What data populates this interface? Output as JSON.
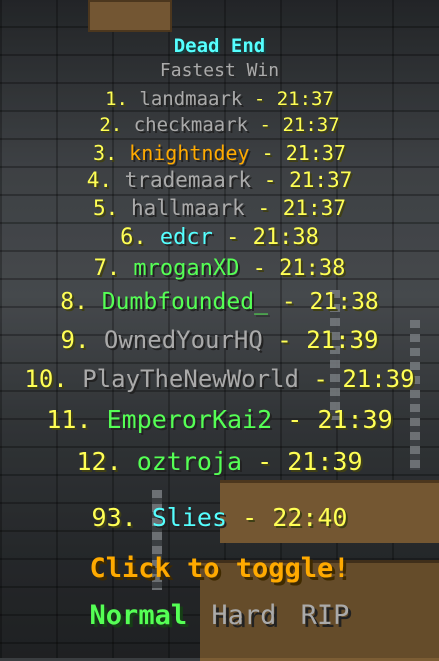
{
  "scoreboard": {
    "title": "Dead End",
    "subtitle": "Fastest Win",
    "separator": "-",
    "entries": [
      {
        "rank": "1.",
        "name": "landmaark",
        "time": "21:37",
        "color": "#aaaaaa"
      },
      {
        "rank": "2.",
        "name": "checkmaark",
        "time": "21:37",
        "color": "#aaaaaa"
      },
      {
        "rank": "3.",
        "name": "knightndey",
        "time": "21:37",
        "color": "#ffaa00"
      },
      {
        "rank": "4.",
        "name": "trademaark",
        "time": "21:37",
        "color": "#aaaaaa"
      },
      {
        "rank": "5.",
        "name": "hallmaark",
        "time": "21:37",
        "color": "#aaaaaa"
      },
      {
        "rank": "6.",
        "name": "edcr",
        "time": "21:38",
        "color": "#55ffff"
      },
      {
        "rank": "7.",
        "name": "mroganXD",
        "time": "21:38",
        "color": "#55ff55"
      },
      {
        "rank": "8.",
        "name": "Dumbfounded_",
        "time": "21:38",
        "color": "#55ff55"
      },
      {
        "rank": "9.",
        "name": "OwnedYourHQ",
        "time": "21:39",
        "color": "#aaaaaa"
      },
      {
        "rank": "10.",
        "name": "PlayTheNewWorld",
        "time": "21:39",
        "color": "#aaaaaa"
      },
      {
        "rank": "11.",
        "name": "EmperorKai2",
        "time": "21:39",
        "color": "#55ff55"
      },
      {
        "rank": "12.",
        "name": "oztroja",
        "time": "21:39",
        "color": "#55ff55"
      }
    ],
    "personal": {
      "rank": "93.",
      "name": "Slies",
      "time": "22:40",
      "color": "#55ffff"
    },
    "toggle_label": "Click to toggle!",
    "modes": [
      {
        "label": "Normal",
        "active": true
      },
      {
        "label": "Hard",
        "active": false
      },
      {
        "label": "RIP",
        "active": false
      }
    ]
  }
}
